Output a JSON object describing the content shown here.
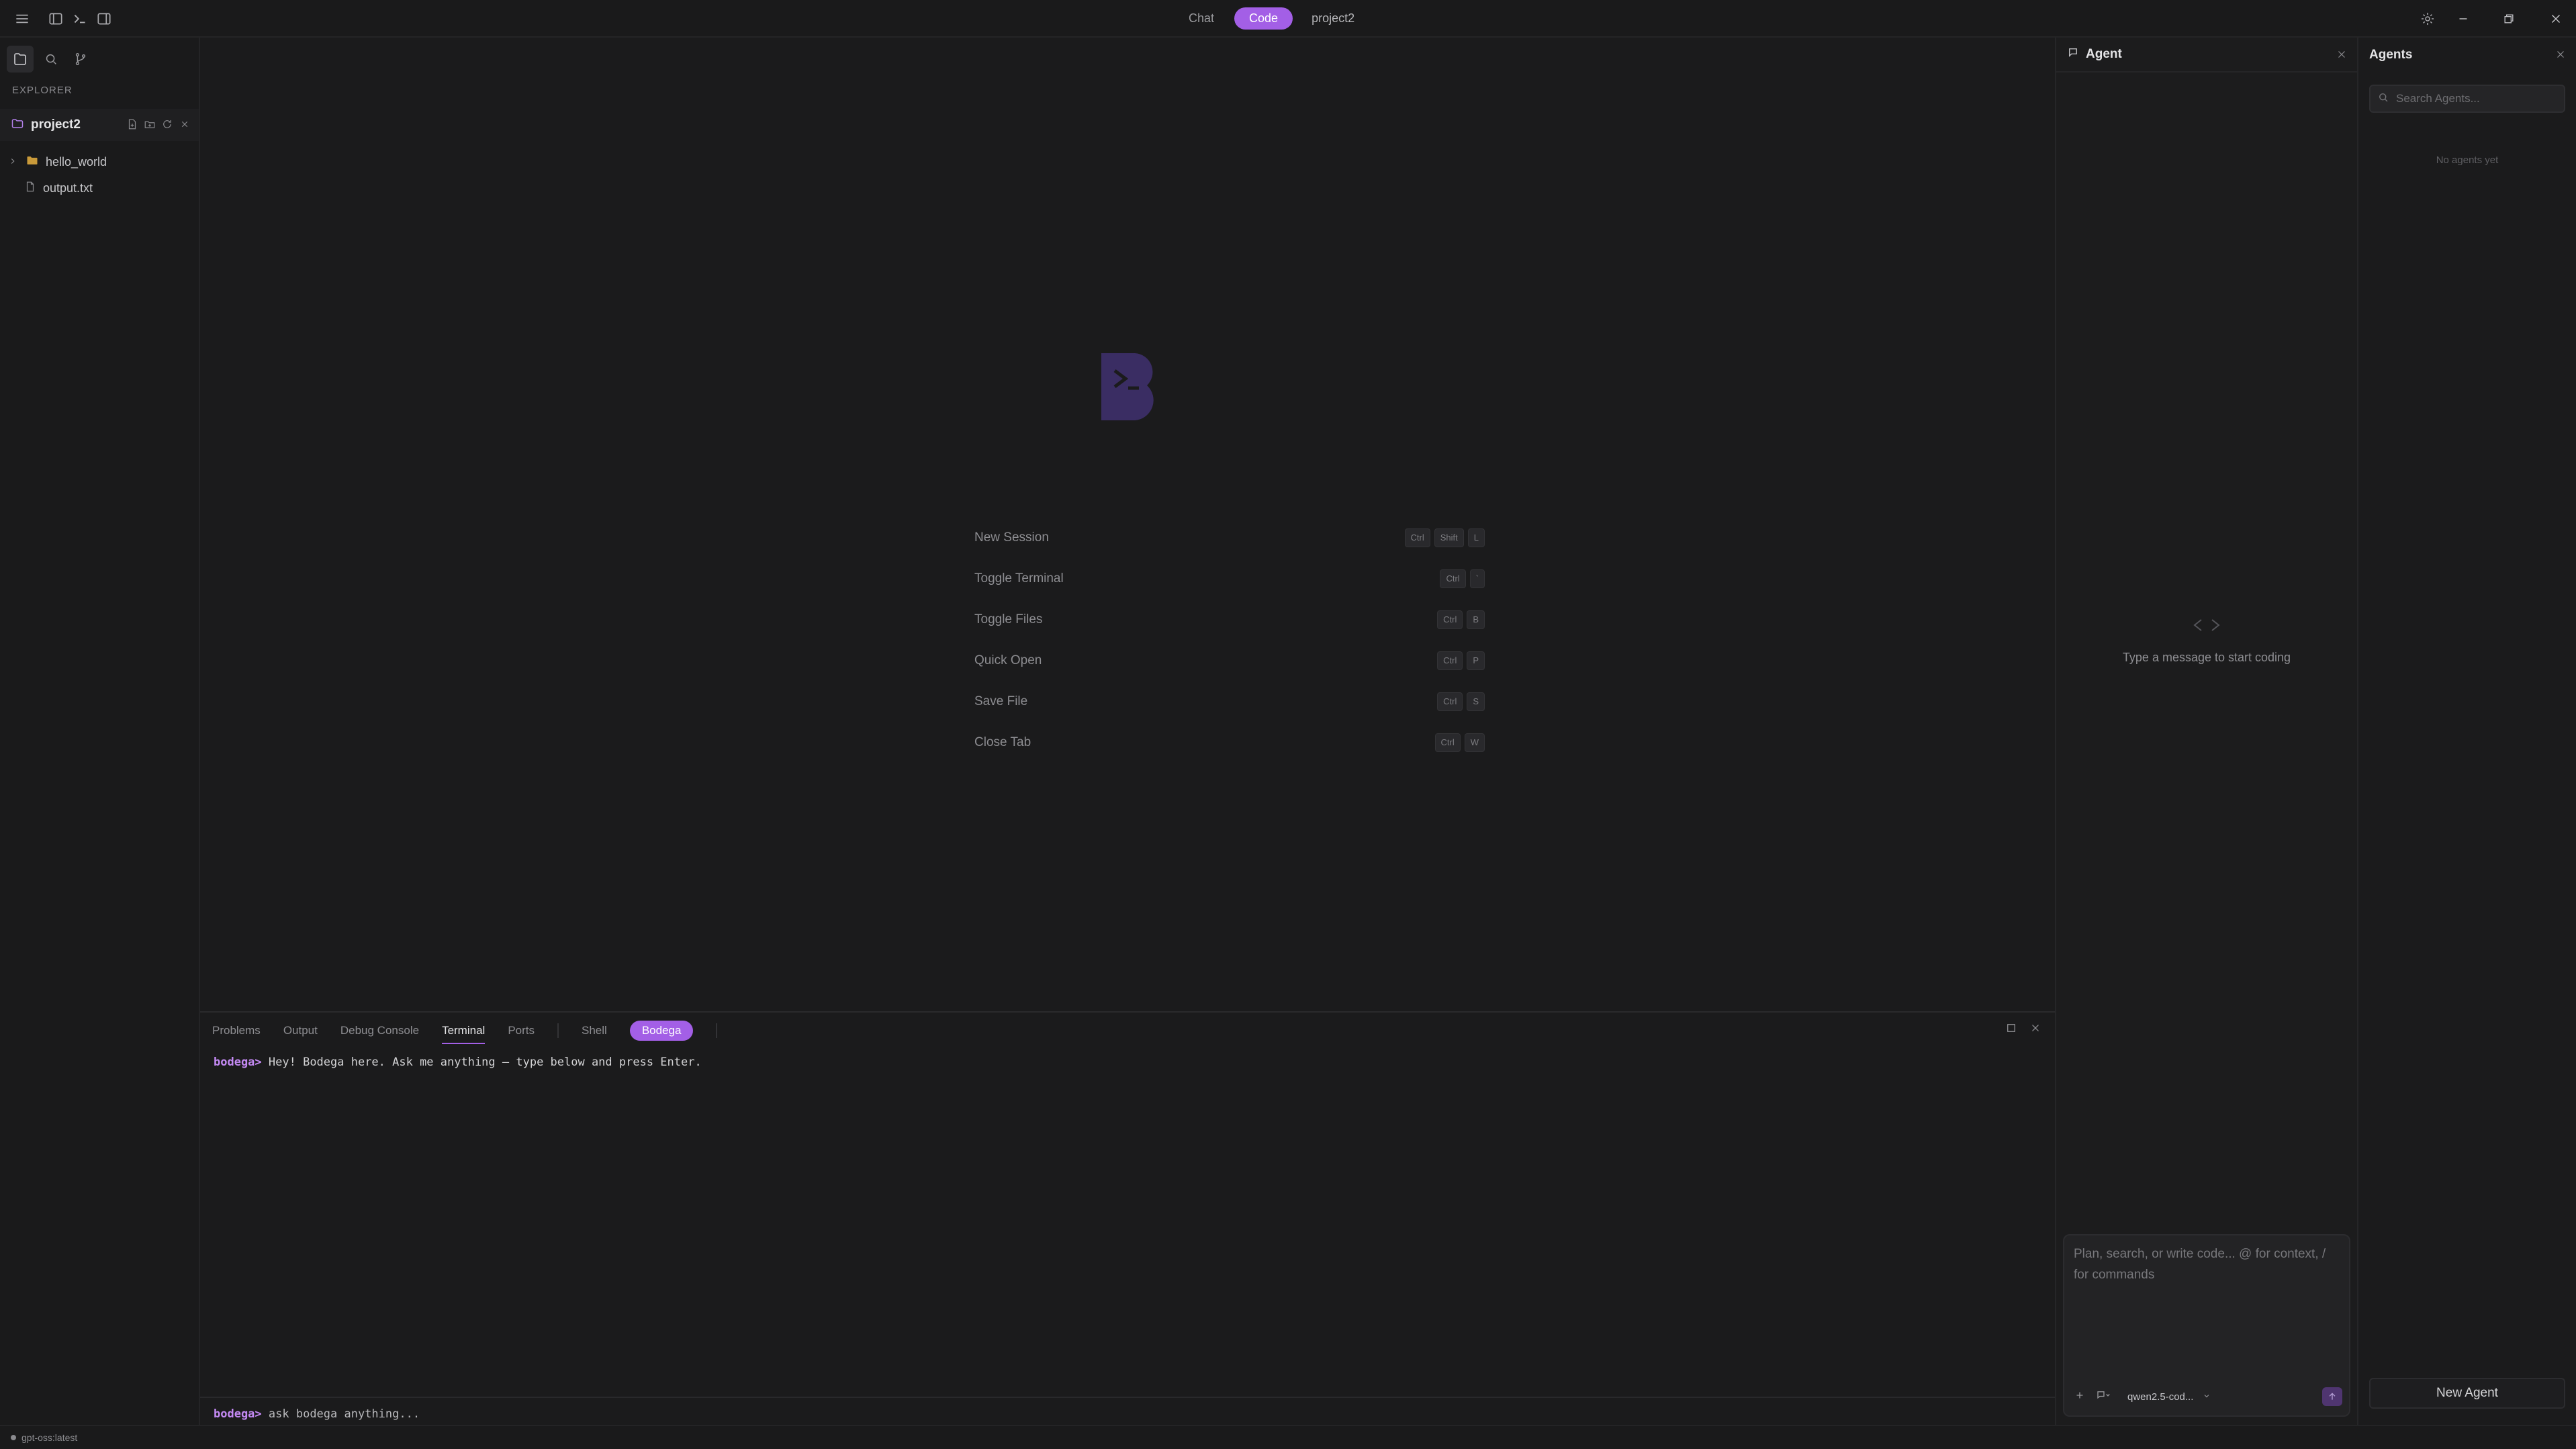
{
  "titlebar": {
    "tabs": {
      "chat": "Chat",
      "code": "Code"
    },
    "project": "project2"
  },
  "explorer": {
    "title": "EXPLORER",
    "project": "project2",
    "items": [
      {
        "name": "hello_world",
        "type": "folder"
      },
      {
        "name": "output.txt",
        "type": "file"
      }
    ]
  },
  "editor": {
    "shortcuts": [
      {
        "label": "New Session",
        "keys": [
          "Ctrl",
          "Shift",
          "L"
        ]
      },
      {
        "label": "Toggle Terminal",
        "keys": [
          "Ctrl",
          "`"
        ]
      },
      {
        "label": "Toggle Files",
        "keys": [
          "Ctrl",
          "B"
        ]
      },
      {
        "label": "Quick Open",
        "keys": [
          "Ctrl",
          "P"
        ]
      },
      {
        "label": "Save File",
        "keys": [
          "Ctrl",
          "S"
        ]
      },
      {
        "label": "Close Tab",
        "keys": [
          "Ctrl",
          "W"
        ]
      }
    ]
  },
  "panel": {
    "tabs": {
      "problems": "Problems",
      "output": "Output",
      "debug": "Debug Console",
      "terminal": "Terminal",
      "ports": "Ports"
    },
    "shells": {
      "shell": "Shell",
      "bodega": "Bodega"
    },
    "prompt": "bodega>",
    "greeting": "Hey! Bodega here. Ask me anything — type below and press Enter.",
    "input_placeholder": "ask bodega anything..."
  },
  "agent": {
    "title": "Agent",
    "empty_message": "Type a message to start coding",
    "composer_placeholder": "Plan, search, or write code... @ for context, / for commands",
    "model": "qwen2.5-cod..."
  },
  "agents": {
    "title": "Agents",
    "search_placeholder": "Search Agents...",
    "empty": "No agents yet",
    "new_button": "New Agent"
  },
  "status": {
    "model": "gpt-oss:latest"
  },
  "colors": {
    "accent": "#a35fe6",
    "background": "#1b1b1c",
    "logo": "#3a2d63"
  }
}
